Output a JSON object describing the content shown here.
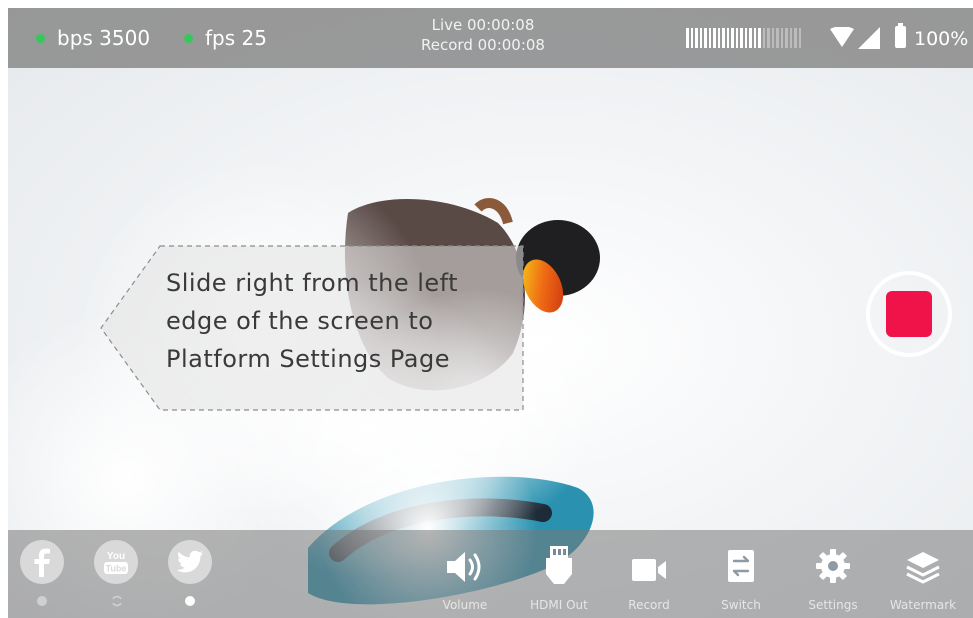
{
  "status": {
    "bps_label": "bps 3500",
    "fps_label": "fps 25",
    "live_time": "Live 00:00:08",
    "record_time": "Record 00:00:08",
    "battery": "100%",
    "indicator_color": "#32c85a"
  },
  "tooltip": {
    "lines": [
      "Slide right from the left",
      "edge of the screen to",
      "Platform Settings Page"
    ]
  },
  "record_button": {
    "color": "#f0134a",
    "icon": "stop-record-icon"
  },
  "platforms": [
    {
      "name": "facebook-icon",
      "glyph": "f"
    },
    {
      "name": "youtube-icon",
      "glyph": "You Tube"
    },
    {
      "name": "twitter-icon",
      "glyph": "twitter-bird"
    }
  ],
  "toolbar": {
    "volume": "Volume",
    "hdmi_out": "HDMI Out",
    "record": "Record",
    "switch": "Switch",
    "settings": "Settings",
    "watermark": "Watermark"
  }
}
